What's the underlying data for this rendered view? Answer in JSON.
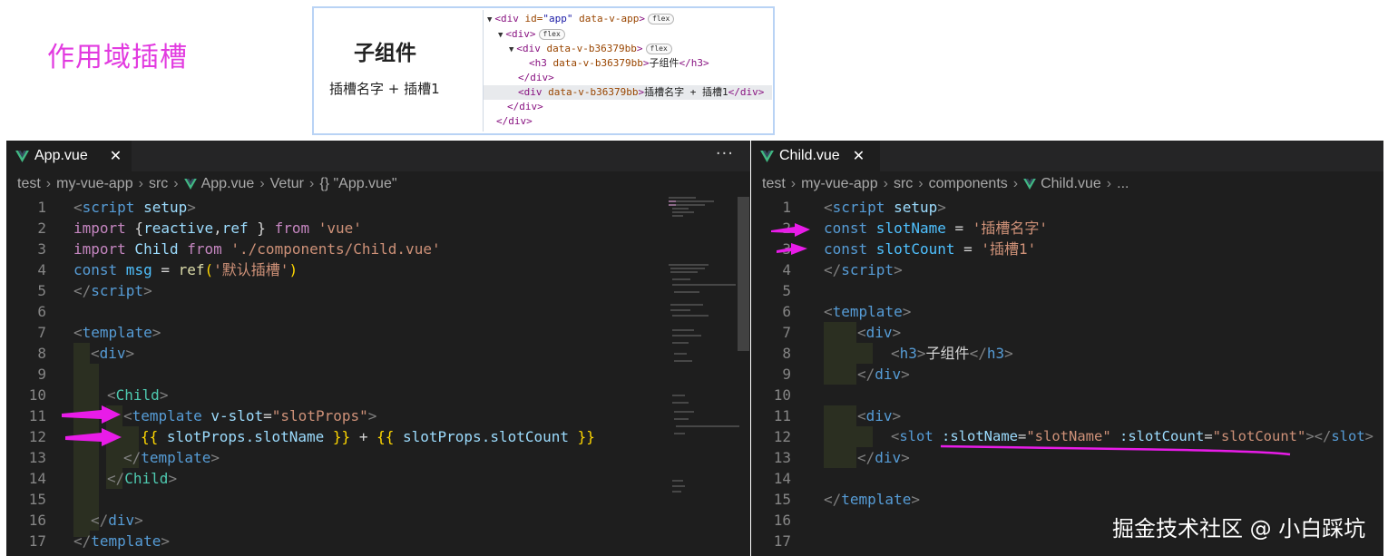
{
  "page_label": "作用域插槽",
  "preview": {
    "heading": "子组件",
    "text": "插槽名字 + 插槽1"
  },
  "devtools": {
    "badge": "flex",
    "lines": [
      {
        "tag_open": "<div",
        "attr": " id=",
        "val": "\"app\"",
        "attr2": " data-v-app",
        "close": ">",
        "text": "",
        "end": ""
      },
      {
        "tag_open": "<div",
        "attr": "",
        "val": "",
        "attr2": "",
        "close": ">",
        "text": "",
        "end": ""
      },
      {
        "tag_open": "<div",
        "attr": " data-v-b36379bb",
        "val": "",
        "attr2": "",
        "close": ">",
        "text": "",
        "end": ""
      },
      {
        "tag_open": "<h3",
        "attr": " data-v-b36379bb",
        "val": "",
        "attr2": "",
        "close": ">",
        "text": "子组件",
        "end": "</h3>"
      },
      {
        "tag_open": "</div>",
        "attr": "",
        "val": "",
        "attr2": "",
        "close": "",
        "text": "",
        "end": ""
      },
      {
        "tag_open": "<div",
        "attr": " data-v-b36379bb",
        "val": "",
        "attr2": "",
        "close": ">",
        "text": "插槽名字 + 插槽1",
        "end": "</div>"
      },
      {
        "tag_open": "</div>",
        "attr": "",
        "val": "",
        "attr2": "",
        "close": "",
        "text": "",
        "end": ""
      },
      {
        "tag_open": "</div>",
        "attr": "",
        "val": "",
        "attr2": "",
        "close": "",
        "text": "",
        "end": ""
      }
    ]
  },
  "left_editor": {
    "tab_label": "App.vue",
    "close_glyph": "✕",
    "more_glyph": "···",
    "breadcrumb": [
      "test",
      "my-vue-app",
      "src",
      "App.vue",
      "Vetur",
      "{} \"App.vue\""
    ],
    "line_numbers": [
      "1",
      "2",
      "3",
      "4",
      "5",
      "6",
      "7",
      "8",
      "9",
      "10",
      "11",
      "12",
      "13",
      "14",
      "15",
      "16",
      "17"
    ],
    "code": {
      "l1": [
        "<",
        "script",
        " setup",
        ">"
      ],
      "l2": [
        "import",
        " {",
        "reactive",
        ",",
        "ref",
        " } ",
        "from",
        " 'vue'"
      ],
      "l3": [
        "import",
        " Child ",
        "from",
        " './components/Child.vue'"
      ],
      "l4": [
        "const",
        " msg",
        " = ",
        "ref",
        "(",
        "'默认插槽'",
        ")"
      ],
      "l5": [
        "</",
        "script",
        ">"
      ],
      "l7": [
        "<",
        "template",
        ">"
      ],
      "l8": [
        "<",
        "div",
        ">"
      ],
      "l10": [
        "<",
        "Child",
        ">"
      ],
      "l11": [
        "<",
        "template",
        " v-slot",
        "=",
        "\"slotProps\"",
        ">"
      ],
      "l12": [
        "{{",
        " slotProps.slotName ",
        "}}",
        " + ",
        "{{",
        " slotProps.slotCount ",
        "}}"
      ],
      "l13": [
        "</",
        "template",
        ">"
      ],
      "l14": [
        "</",
        "Child",
        ">"
      ],
      "l16": [
        "</",
        "div",
        ">"
      ],
      "l17": [
        "</",
        "template",
        ">"
      ]
    }
  },
  "right_editor": {
    "tab_label": "Child.vue",
    "close_glyph": "✕",
    "breadcrumb": [
      "test",
      "my-vue-app",
      "src",
      "components",
      "Child.vue",
      "..."
    ],
    "line_numbers": [
      "1",
      "2",
      "3",
      "4",
      "5",
      "6",
      "7",
      "8",
      "9",
      "10",
      "11",
      "12",
      "13",
      "14",
      "15",
      "16",
      "17"
    ],
    "code": {
      "l1": [
        "<",
        "script",
        " setup",
        ">"
      ],
      "l2": [
        "const",
        " slotName",
        " = ",
        "'插槽名字'"
      ],
      "l3": [
        "const",
        " slotCount",
        " = ",
        "'插槽1'"
      ],
      "l4": [
        "</",
        "script",
        ">"
      ],
      "l6": [
        "<",
        "template",
        ">"
      ],
      "l7": [
        "<",
        "div",
        ">"
      ],
      "l8": [
        "<",
        "h3",
        ">",
        "子组件",
        "</",
        "h3",
        ">"
      ],
      "l9": [
        "</",
        "div",
        ">"
      ],
      "l11": [
        "<",
        "div",
        ">"
      ],
      "l12": [
        "<",
        "slot",
        " :slotName",
        "=",
        "\"slotName\"",
        " :slotCount",
        "=",
        "\"slotCount\"",
        "></",
        "slot",
        ">"
      ],
      "l13": [
        "</",
        "div",
        ">"
      ],
      "l15": [
        "</",
        "template",
        ">"
      ]
    }
  },
  "watermark": "掘金技术社区 @ 小白踩坑",
  "colors": {
    "annotation_magenta": "#e81ce8",
    "editor_bg": "#1e1e1e",
    "vue_green": "#41b883"
  }
}
